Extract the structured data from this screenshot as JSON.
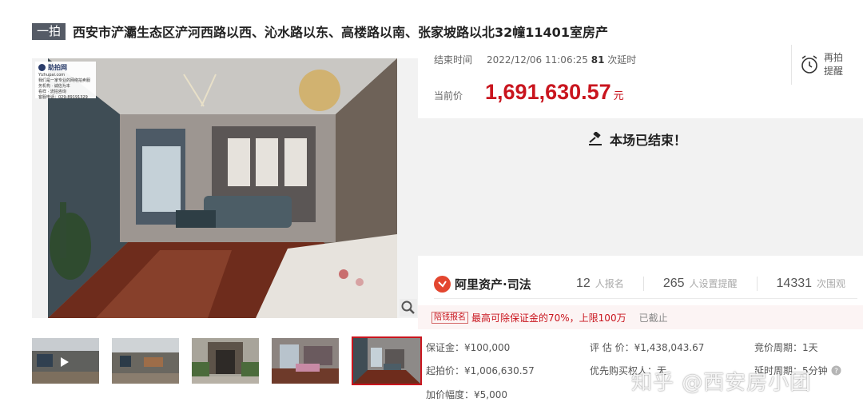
{
  "listing": {
    "tag": "一拍",
    "title": "西安市浐灞生态区浐河西路以西、沁水路以东、高楼路以南、张家坡路以北32幢11401室房产"
  },
  "watermark_logo": {
    "brand": "助拍网",
    "domain": "Yizhupai.com",
    "line1": "我们是一家专业的网络拍卖服务机构 · 诚信为本",
    "line2": "看样 · 流拍咨询",
    "line3": "客服电话：029-89191329"
  },
  "auction": {
    "end_label": "结束时间",
    "end_time": "2022/12/06 11:06:25",
    "delay_count": "81",
    "delay_suffix": "次延时",
    "price_label": "当前价",
    "price": "1,691,630.57",
    "price_unit": "元",
    "status": "本场已结束！",
    "remind_label": "再拍提醒"
  },
  "platform": {
    "name": "阿里资产·司法",
    "signups": "12",
    "signups_label": "人报名",
    "reminders": "265",
    "reminders_label": "人设置提醒",
    "views": "14331",
    "views_label": "次围观"
  },
  "deposit": {
    "tag": "陪钱报名",
    "text": "最高可除保证金的70%，上限100万",
    "note": "已截止"
  },
  "details": {
    "deposit": "保证金：¥100,000",
    "start_price": "起拍价：¥1,006,630.57",
    "increment": "加价幅度：¥5,000",
    "appraisal": "评 估 价：¥1,438,043.67",
    "priority": "优先购买权人：无",
    "cycle": "竞价周期：1天",
    "delay_period": "延时周期：5分钟"
  },
  "watermark_text": "知乎 @西安房小团",
  "colors": {
    "accent": "#c9151e",
    "ali": "#e3462f",
    "tag_bg": "#555b66"
  },
  "icons": [
    "zoom-icon",
    "alarm-clock-icon",
    "gavel-icon",
    "ali-logo-icon",
    "help-icon",
    "play-icon"
  ]
}
